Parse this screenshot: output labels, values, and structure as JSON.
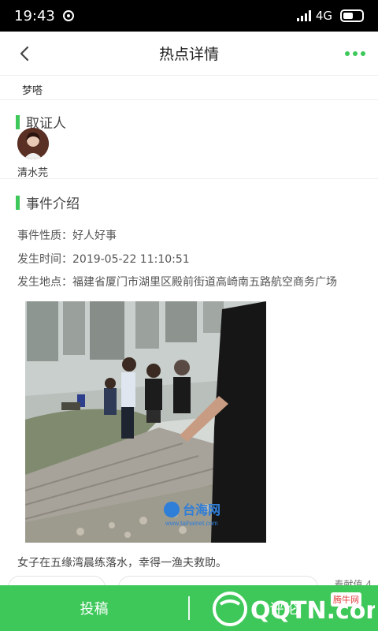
{
  "status_bar": {
    "time": "19:43",
    "network": "4G"
  },
  "header": {
    "title": "热点详情"
  },
  "prev_item_name": "梦嗒",
  "witness_section": {
    "title": "取证人",
    "name": "清水芫"
  },
  "event_section": {
    "title": "事件介绍",
    "nature_label": "事件性质：",
    "nature_value": "好人好事",
    "time_label": "发生时间：",
    "time_value": "2019-05-22 11:10:51",
    "location_label": "发生地点：",
    "location_value": "福建省厦门市湖里区殿前街道高崎南五路航空商务广场"
  },
  "photo": {
    "watermark_cn": "台海网",
    "watermark_url": "www.taihainet.com"
  },
  "caption": "女子在五缘湾晨练落水，幸得一渔夫救助。",
  "partial_label": "奉献值 4",
  "bottom_bar": {
    "submit_label": "投稿",
    "comment_label": "评论"
  },
  "watermark": {
    "logo_text": "QQTN.com",
    "site_label": "腾牛网"
  },
  "colors": {
    "accent": "#3ec85a",
    "status_bar": "#000000"
  }
}
